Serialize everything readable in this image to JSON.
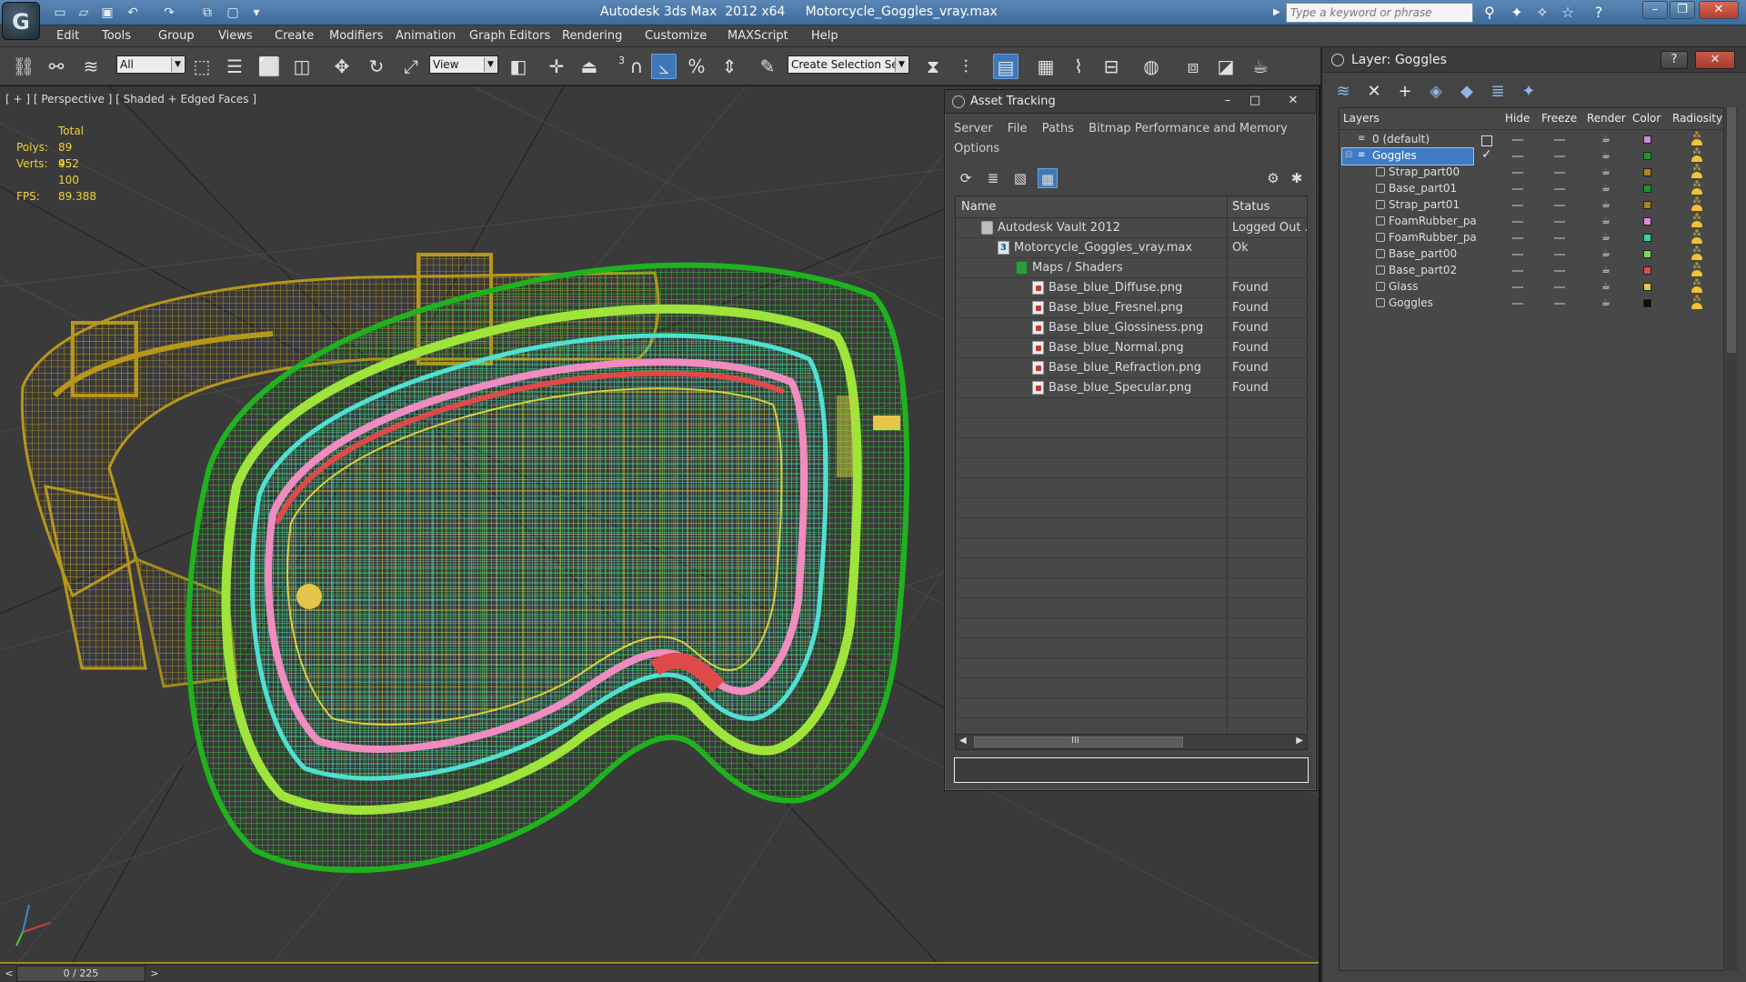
{
  "titlebar": {
    "title": "Autodesk 3ds Max  2012 x64     Motorcycle_Goggles_vray.max",
    "search_placeholder": "Type a keyword or phrase"
  },
  "menu": [
    "Edit",
    "Tools",
    "Group",
    "Views",
    "Create",
    "Modifiers",
    "Animation",
    "Graph Editors",
    "Rendering",
    "Customize",
    "MAXScript",
    "Help"
  ],
  "toolbar": {
    "selection_filter": "All",
    "reference_coord": "View",
    "snap_label": "3",
    "named_selection_placeholder": "Create Selection Se"
  },
  "viewport": {
    "label": "[ + ] [ Perspective ] [ Shaded + Edged Faces ]",
    "stats_header": "Total",
    "polys_label": "Polys:",
    "polys_value": "89 952",
    "verts_label": "Verts:",
    "verts_value": "45 100",
    "fps_label": "FPS:",
    "fps_value": "89.388"
  },
  "asset_tracking": {
    "title": "Asset Tracking",
    "menu": [
      "Server",
      "File",
      "Paths",
      "Bitmap Performance and Memory",
      "Options"
    ],
    "columns": {
      "name": "Name",
      "status": "Status"
    },
    "rows": [
      {
        "name": "Autodesk Vault 2012",
        "status": "Logged Out ..."
      },
      {
        "name": "Motorcycle_Goggles_vray.max",
        "status": "Ok"
      },
      {
        "name": "Maps / Shaders",
        "status": ""
      },
      {
        "name": "Base_blue_Diffuse.png",
        "status": "Found"
      },
      {
        "name": "Base_blue_Fresnel.png",
        "status": "Found"
      },
      {
        "name": "Base_blue_Glossiness.png",
        "status": "Found"
      },
      {
        "name": "Base_blue_Normal.png",
        "status": "Found"
      },
      {
        "name": "Base_blue_Refraction.png",
        "status": "Found"
      },
      {
        "name": "Base_blue_Specular.png",
        "status": "Found"
      }
    ],
    "scroll_thumb_glyph": "III"
  },
  "layer_panel": {
    "title": "Layer: Goggles",
    "columns": {
      "layers": "Layers",
      "hide": "Hide",
      "freeze": "Freeze",
      "render": "Render",
      "color": "Color",
      "radiosity": "Radiosity"
    },
    "rows": [
      {
        "name": "0 (default)",
        "color": "#c58fd6"
      },
      {
        "name": "Goggles",
        "color": "#1b9a2c"
      },
      {
        "name": "Strap_part00",
        "color": "#a88a1c"
      },
      {
        "name": "Base_part01",
        "color": "#179a25"
      },
      {
        "name": "Strap_part01",
        "color": "#9e861c"
      },
      {
        "name": "FoamRubber_pa",
        "color": "#e38bd8"
      },
      {
        "name": "FoamRubber_pa",
        "color": "#35d7b0"
      },
      {
        "name": "Base_part00",
        "color": "#7ed84f"
      },
      {
        "name": "Base_part02",
        "color": "#e0475a"
      },
      {
        "name": "Glass",
        "color": "#e8c44a"
      },
      {
        "name": "Goggles",
        "color": "#0d0d0d"
      }
    ]
  },
  "timeline": {
    "frame": "0 / 225",
    "prev": "<",
    "next": ">"
  },
  "colors": {
    "strap": "#b7961a",
    "frame_green": "#1fb21f",
    "lime": "#9fe43a",
    "cyan": "#4fe0d2",
    "pink": "#f08cc0",
    "red": "#e0494a"
  }
}
